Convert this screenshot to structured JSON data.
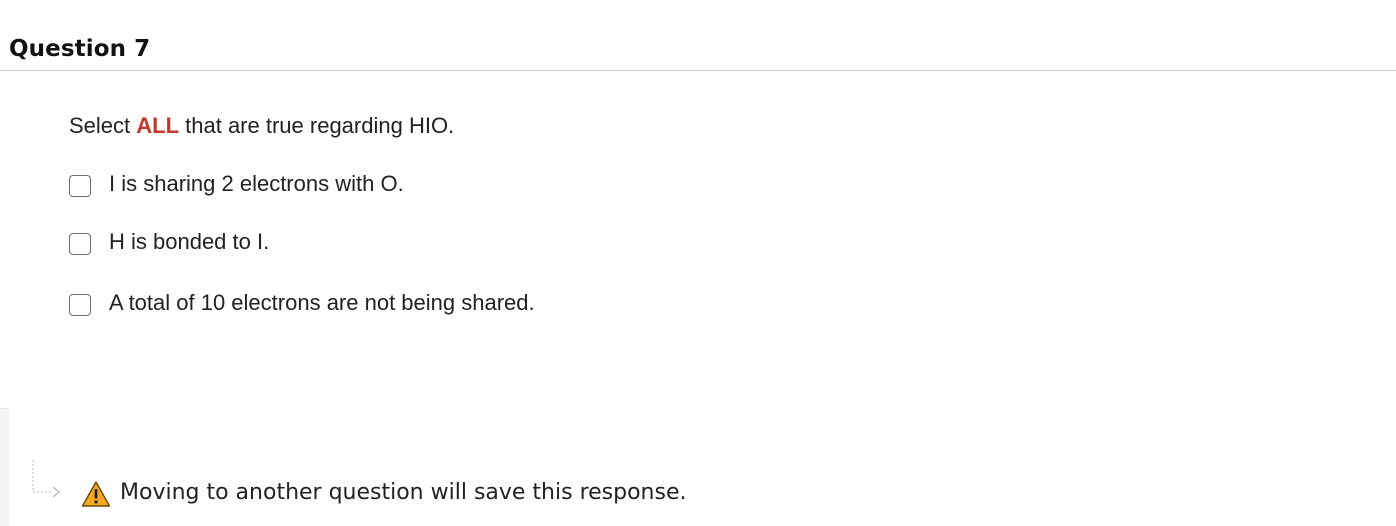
{
  "question": {
    "title": "Question 7",
    "prompt_before": "Select ",
    "prompt_emphasis": "ALL",
    "prompt_after": " that are true regarding HIO.",
    "options": [
      {
        "label": "I is sharing 2 electrons with O.",
        "checked": false
      },
      {
        "label": "H is bonded to I.",
        "checked": false
      },
      {
        "label": "A total of 10 electrons are not being shared.",
        "checked": false
      }
    ]
  },
  "footer": {
    "save_message": "Moving to another question will save this response.",
    "icons": {
      "arrow": "return-arrow-icon",
      "warning": "warning-icon"
    }
  },
  "colors": {
    "emphasis": "#c0392b",
    "warning_fill": "#f5a623",
    "header_rule": "#cfcfcf"
  }
}
